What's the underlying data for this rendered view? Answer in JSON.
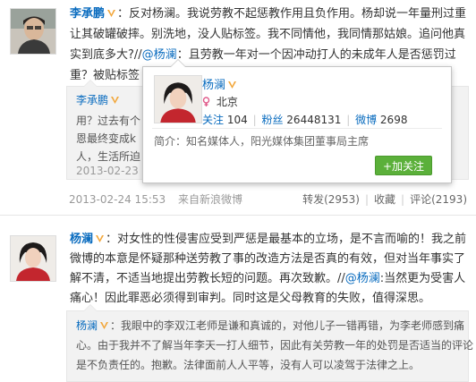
{
  "post1": {
    "author": "李承鹏",
    "lines": [
      "：反对杨澜。我说劳教不起惩教作用且负作用。杨却说一年量刑过重",
      "让其破罐破摔。别洗地，没人贴标签。我不同情他，我同情那姑娘。追问他真",
      "实到底多大?"
    ],
    "line3_rest_prefix": "//",
    "line3_mention": "@杨澜",
    "line3_rest": "：且劳教一年对一个因冲动打人的未成年人是否惩罚过",
    "line4": "重？被贴标签",
    "repost": {
      "author": "李承鹏",
      "lines": [
        "用？过去有个",
        "恩最终变成k",
        "人，生活所迫"
      ],
      "time": "2013-02-23"
    },
    "time": "2013-02-24 15:53",
    "via": "来自新浪微博",
    "actions": {
      "repost": "转发(2953)",
      "fav": "收藏",
      "comment": "评论(2193)"
    }
  },
  "card": {
    "name": "杨澜",
    "location": "北京",
    "follow_label": "关注",
    "follow_count": "104",
    "fans_label": "粉丝",
    "fans_count": "26448131",
    "weibo_label": "微博",
    "weibo_count": "2698",
    "bio": "简介：知名媒体人，阳光媒体集团董事局主席",
    "add_follow": "+加关注"
  },
  "post2": {
    "author": "杨澜",
    "line1": "：对女性的性侵害应受到严惩是最基本的立场，是不言而喻的！我之前",
    "line2": "微博的本意是怀疑那种送劳教了事的改造方法是否真的有效，但对当年事实了",
    "line3": "解不清，不适当地提出劳教长短的问题。再次致歉。//",
    "line3_mention": "@杨澜",
    "line3_tail": ":当然更为受害人",
    "line4": "痛心！因此罪恶必须得到审判。同时这是父母教育的失败，值得深思。",
    "repost": {
      "author": "杨澜",
      "line1": "：我眼中的李双江老师是谦和真诚的，对他儿子一错再错，为李老师感到痛",
      "line2": "心。由于我并不了解当年李天一打人细节，因此有关劳教一年的处罚是否适当的评论",
      "line3": "是不负责任的。抱歉。法律面前人人平等，没有人可以凌驾于法律之上。"
    }
  },
  "colors": {
    "link": "#0a6cbf",
    "follow_button": "#5bb03a",
    "badge": "#f2a73b"
  }
}
